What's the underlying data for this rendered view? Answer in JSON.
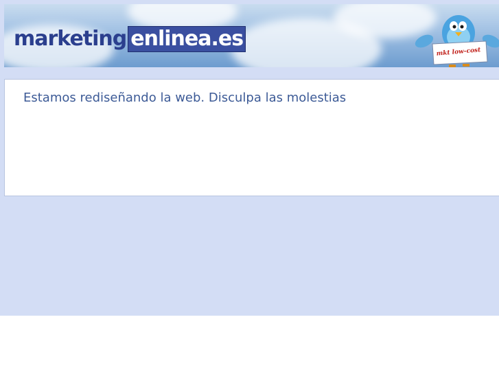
{
  "header": {
    "logo": {
      "part1": "marketing",
      "part2": "enlinea.es"
    },
    "mascot": {
      "sign_text": "mkt low-cost",
      "icon": "bird-mascot-icon"
    }
  },
  "main": {
    "message": "Estamos rediseñando la web. Disculpa las molestias"
  },
  "colors": {
    "page_background": "#d3ddf5",
    "logo_dark": "#2b3f8e",
    "logo_box": "#3a4fa0",
    "message_text": "#3c5a96",
    "sign_text": "#c0201a"
  }
}
